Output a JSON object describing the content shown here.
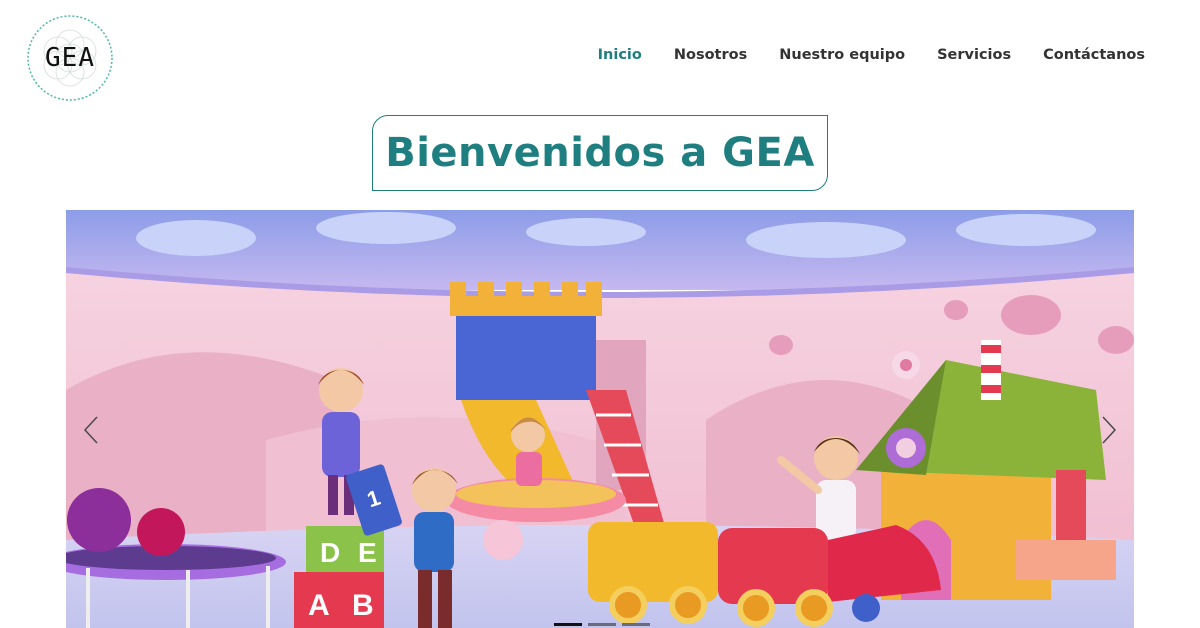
{
  "logo": {
    "text": "GEA"
  },
  "nav": {
    "items": [
      {
        "label": "Inicio"
      },
      {
        "label": "Nosotros"
      },
      {
        "label": "Nuestro equipo"
      },
      {
        "label": "Servicios"
      },
      {
        "label": "Contáctanos"
      }
    ]
  },
  "hero": {
    "title": "Bienvenidos a GEA"
  },
  "slider": {
    "slides_count": 3,
    "active_slide": 1,
    "blocks": {
      "top_left": "D",
      "top_right": "E",
      "bottom_left": "A",
      "bottom_right": "B",
      "card": "1"
    }
  },
  "colors": {
    "accent": "#1f7f80",
    "nav_text": "#333333"
  }
}
